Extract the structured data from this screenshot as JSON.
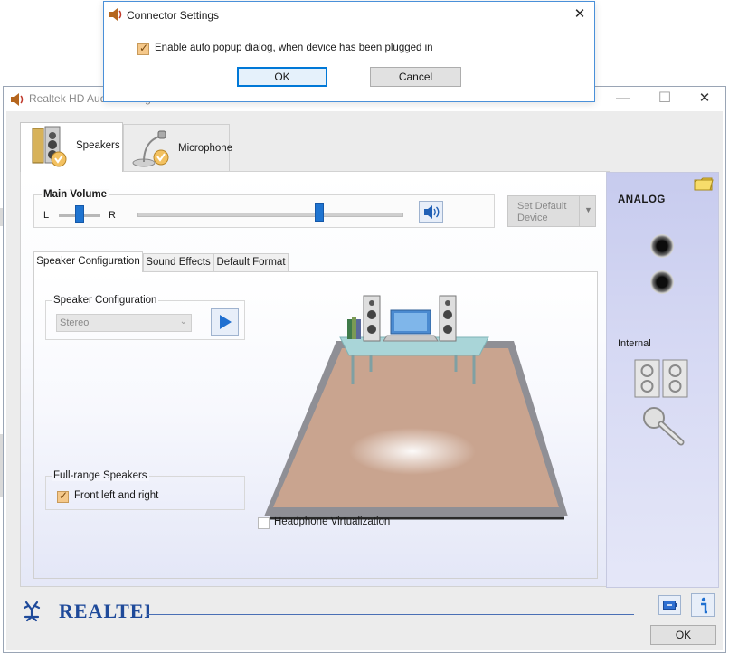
{
  "main_window": {
    "title": "Realtek HD Audio Manager",
    "min_glyph": "—",
    "max_glyph": "☐",
    "close_glyph": "✕"
  },
  "device_tabs": [
    {
      "label": "Speakers",
      "icon": "speakers-icon",
      "selected": true
    },
    {
      "label": "Microphone",
      "icon": "microphone-icon",
      "selected": false
    }
  ],
  "volume": {
    "label": "Main Volume",
    "balance_left": "L",
    "balance_right": "R",
    "balance_value": 0.5,
    "volume_value": 0.69,
    "mute_icon": "speaker-volume-icon"
  },
  "set_default": {
    "label": "Set Default Device",
    "arrow": "▼"
  },
  "inner_tabs": [
    {
      "label": "Speaker Configuration",
      "selected": true
    },
    {
      "label": "Sound Effects",
      "selected": false
    },
    {
      "label": "Default Format",
      "selected": false
    }
  ],
  "speaker_config": {
    "group_label": "Speaker Configuration",
    "selected": "Stereo",
    "play_icon": "play-icon"
  },
  "fullrange": {
    "group_label": "Full-range Speakers",
    "front_lr_label": "Front left and right",
    "front_lr_checked": true
  },
  "headphone": {
    "label": "Headphone Virtualization",
    "checked": false
  },
  "analog_panel": {
    "title": "ANALOG",
    "internal_label": "Internal",
    "folder_icon": "folder-icon"
  },
  "bottom": {
    "brand": "REALTEK",
    "ok_label": "OK",
    "battery_icon": "battery-icon",
    "info_icon": "info-icon"
  },
  "connector_dialog": {
    "title": "Connector Settings",
    "close_glyph": "✕",
    "autopopup_label": "Enable auto popup dialog, when device has been plugged in",
    "autopopup_checked": true,
    "ok_label": "OK",
    "cancel_label": "Cancel"
  },
  "colors": {
    "accent_blue": "#1f74d0",
    "dialog_border": "#0078d7",
    "analog_panel": "#cdd1f0",
    "floor": "#c9a48f"
  }
}
